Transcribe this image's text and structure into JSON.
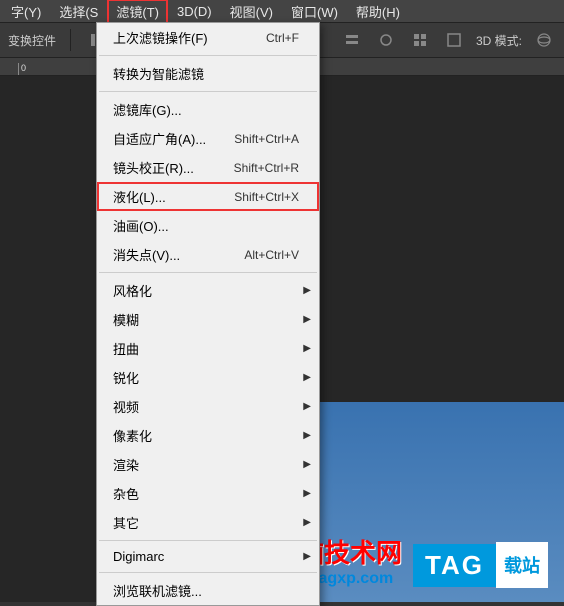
{
  "menubar": {
    "items": [
      {
        "label": "字(Y)"
      },
      {
        "label": "选择(S"
      },
      {
        "label": "滤镜(T)"
      },
      {
        "label": "3D(D)"
      },
      {
        "label": "视图(V)"
      },
      {
        "label": "窗口(W)"
      },
      {
        "label": "帮助(H)"
      }
    ]
  },
  "toolbar": {
    "label_left": "变换控件",
    "mode3d_label": "3D 模式:"
  },
  "ruler": {
    "ticks": [
      "0"
    ]
  },
  "dropdown": {
    "last_filter": {
      "label": "上次滤镜操作(F)",
      "shortcut": "Ctrl+F"
    },
    "convert_smart": {
      "label": "转换为智能滤镜"
    },
    "filter_gallery": {
      "label": "滤镜库(G)..."
    },
    "adaptive_wide": {
      "label": "自适应广角(A)...",
      "shortcut": "Shift+Ctrl+A"
    },
    "lens_correct": {
      "label": "镜头校正(R)...",
      "shortcut": "Shift+Ctrl+R"
    },
    "liquify": {
      "label": "液化(L)...",
      "shortcut": "Shift+Ctrl+X"
    },
    "oil_paint": {
      "label": "油画(O)..."
    },
    "vanishing_point": {
      "label": "消失点(V)...",
      "shortcut": "Alt+Ctrl+V"
    },
    "stylize": {
      "label": "风格化"
    },
    "blur": {
      "label": "模糊"
    },
    "distort": {
      "label": "扭曲"
    },
    "sharpen": {
      "label": "锐化"
    },
    "video": {
      "label": "视频"
    },
    "pixelate": {
      "label": "像素化"
    },
    "render": {
      "label": "渲染"
    },
    "noise": {
      "label": "杂色"
    },
    "other": {
      "label": "其它"
    },
    "digimarc": {
      "label": "Digimarc"
    },
    "browse_online": {
      "label": "浏览联机滤镜..."
    }
  },
  "watermark": {
    "title": "电脑技术网",
    "url": "www.tagxp.com"
  },
  "tag": {
    "text": "TAG",
    "suffix": "载站"
  }
}
